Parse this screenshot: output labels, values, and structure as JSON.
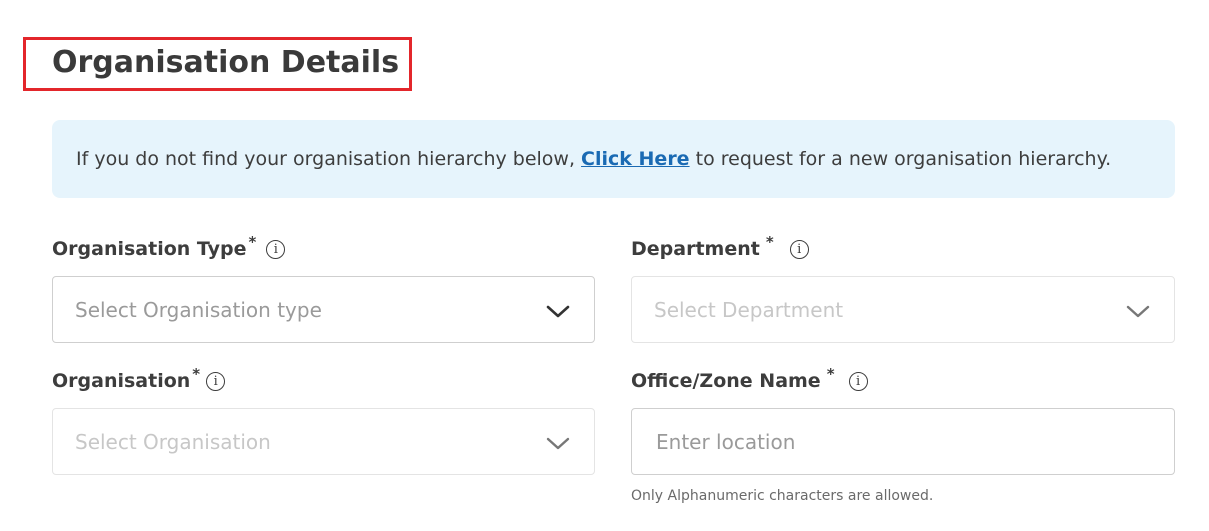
{
  "header": {
    "title": "Organisation Details"
  },
  "banner": {
    "text_before": "If you do not find your organisation hierarchy below, ",
    "link_text": "Click Here",
    "text_after": " to request for a new organisation hierarchy."
  },
  "fields": {
    "org_type": {
      "label": "Organisation Type",
      "required": "*",
      "placeholder": "Select Organisation type"
    },
    "department": {
      "label": "Department",
      "required": "*",
      "placeholder": "Select Department"
    },
    "organisation": {
      "label": "Organisation",
      "required": "*",
      "placeholder": "Select Organisation"
    },
    "office": {
      "label": "Office/Zone Name",
      "required": "*",
      "placeholder": "Enter location",
      "hint": "Only Alphanumeric characters are allowed."
    }
  },
  "icons": {
    "info": "info-icon",
    "dropdown": "chevron-down-icon"
  },
  "colors": {
    "highlight_border": "#e3262b",
    "banner_bg": "#e6f4fc",
    "link": "#1a6ab3"
  }
}
